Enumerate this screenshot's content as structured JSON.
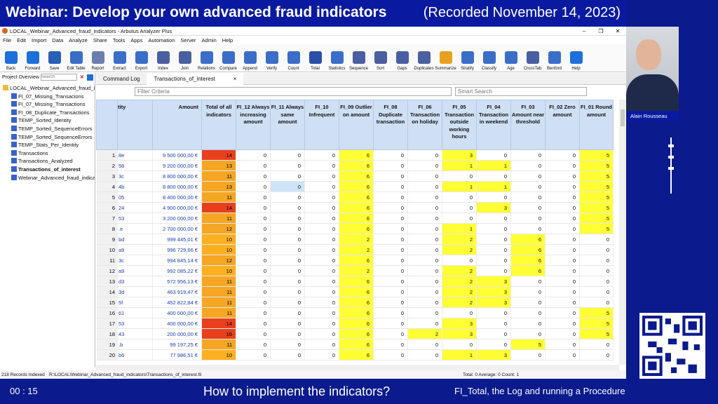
{
  "banner": {
    "title": "Webinar: Develop your own advanced fraud indicators",
    "date": "(Recorded November 14, 2023)"
  },
  "window": {
    "title": "LOCAL_Webinar_Advanced_fraud_indicators - Arbutus Analyzer Plus"
  },
  "menu": [
    "File",
    "Edit",
    "Import",
    "Data",
    "Analyze",
    "Share",
    "Tools",
    "Apps",
    "Automation",
    "Server",
    "Admin",
    "Help"
  ],
  "toolbar": [
    {
      "label": "Back",
      "icon": "back-arrow-icon",
      "color": "#1e6fd9"
    },
    {
      "label": "Forward",
      "icon": "forward-arrow-icon",
      "color": "#1e6fd9"
    },
    {
      "label": "Save",
      "icon": "save-icon",
      "color": "#2a5fb8"
    },
    {
      "label": "Edit Table",
      "icon": "edit-table-icon",
      "color": "#3a6ec8"
    },
    {
      "label": "Report",
      "icon": "report-icon",
      "color": "#6a7fb0"
    },
    {
      "label": "Extract",
      "icon": "extract-icon",
      "color": "#3a6ec8"
    },
    {
      "label": "Export",
      "icon": "export-icon",
      "color": "#3a6ec8"
    },
    {
      "label": "Index",
      "icon": "index-icon",
      "color": "#4a5fa0"
    },
    {
      "label": "Join",
      "icon": "join-icon",
      "color": "#4a5fa0"
    },
    {
      "label": "Relations",
      "icon": "relations-icon",
      "color": "#3a6ec8"
    },
    {
      "label": "Compare",
      "icon": "compare-icon",
      "color": "#3a6ec8"
    },
    {
      "label": "Append",
      "icon": "append-icon",
      "color": "#3a6ec8"
    },
    {
      "label": "Verify",
      "icon": "verify-icon",
      "color": "#3a6ec8"
    },
    {
      "label": "Count",
      "icon": "count-icon",
      "color": "#3a6ec8"
    },
    {
      "label": "Total",
      "icon": "total-icon",
      "color": "#2a4fa8"
    },
    {
      "label": "Statistics",
      "icon": "statistics-icon",
      "color": "#3a6ec8"
    },
    {
      "label": "Sequence",
      "icon": "sequence-icon",
      "color": "#4a5fa0"
    },
    {
      "label": "Sort",
      "icon": "sort-icon",
      "color": "#4a5fa0"
    },
    {
      "label": "Gaps",
      "icon": "gaps-icon",
      "color": "#4a5fa0"
    },
    {
      "label": "Duplicates",
      "icon": "duplicates-icon",
      "color": "#4a5fa0"
    },
    {
      "label": "Summarize",
      "icon": "summarize-icon",
      "color": "#e8a020"
    },
    {
      "label": "Stratify",
      "icon": "stratify-icon",
      "color": "#3a6ec8"
    },
    {
      "label": "Classify",
      "icon": "classify-icon",
      "color": "#3a6ec8"
    },
    {
      "label": "Age",
      "icon": "age-icon",
      "color": "#3a6ec8"
    },
    {
      "label": "CrossTab",
      "icon": "crosstab-icon",
      "color": "#4a5fa0"
    },
    {
      "label": "Benford",
      "icon": "benford-icon",
      "color": "#3a6ec8"
    },
    {
      "label": "Help",
      "icon": "help-icon",
      "color": "#1e6fd9"
    }
  ],
  "project": {
    "label": "Project Overview",
    "search_placeholder": "Search",
    "items": [
      {
        "label": "LOCAL_Webinar_Advanced_fraud_indicators",
        "bold": false,
        "root": true
      },
      {
        "label": "FI_07_Missing_Transacions",
        "bold": false
      },
      {
        "label": "FI_07_Missing_Transactions",
        "bold": false
      },
      {
        "label": "FI_08_Duplicate_Transactions",
        "bold": false
      },
      {
        "label": "TEMP_Sorted_Identity",
        "bold": false
      },
      {
        "label": "TEMP_Sorted_SequenceErrors",
        "bold": false
      },
      {
        "label": "TEMP_Sorted_SequenceErrors",
        "bold": false
      },
      {
        "label": "TEMP_Stats_Per_Identity",
        "bold": false
      },
      {
        "label": "Transactions",
        "bold": false
      },
      {
        "label": "Transactions_Analyzed",
        "bold": false
      },
      {
        "label": "Transactions_of_interest",
        "bold": true
      },
      {
        "label": "Webinar_Advanced_fraud_indicators",
        "bold": false
      }
    ]
  },
  "tabs": [
    {
      "label": "Command Log",
      "active": false
    },
    {
      "label": "Transactions_of_interest",
      "active": true
    }
  ],
  "tab_close": "×",
  "filter": {
    "placeholder": "Filter Criteria"
  },
  "smart_search": {
    "placeholder": "Smart Search"
  },
  "table": {
    "columns": [
      "",
      "tity",
      "Amount",
      "Total of all indicators",
      "FI_12 Always increasing amount",
      "FI_11 Always same amount",
      "FI_10 Infrequent",
      "FI_09 Outlier on amount",
      "FI_08 Duplicate transaction",
      "FI_06 Transaction on holiday",
      "FI_05 Transaction outside working hours",
      "FI_04 Transaction in weekend",
      "FI_03 Amount near threshold",
      "FI_02 Zero amount",
      "FI_01 Round amount"
    ],
    "rows": [
      [
        "1",
        "8e",
        "9 500 000,00 €",
        "14",
        "0",
        "0",
        "0",
        "6",
        "0",
        "0",
        "3",
        "0",
        "0",
        "0",
        "5"
      ],
      [
        "2",
        "58",
        "9 200 000,00 €",
        "13",
        "0",
        "0",
        "0",
        "6",
        "0",
        "0",
        "1",
        "1",
        "0",
        "0",
        "5"
      ],
      [
        "3",
        "3c",
        "8 800 000,00 €",
        "11",
        "0",
        "0",
        "0",
        "6",
        "0",
        "0",
        "0",
        "0",
        "0",
        "0",
        "5"
      ],
      [
        "4",
        "4b",
        "8 800 000,00 €",
        "13",
        "0",
        "0",
        "0",
        "6",
        "0",
        "0",
        "1",
        "1",
        "0",
        "0",
        "5"
      ],
      [
        "5",
        "05",
        "8 400 000,00 €",
        "11",
        "0",
        "0",
        "0",
        "6",
        "0",
        "0",
        "0",
        "0",
        "0",
        "0",
        "5"
      ],
      [
        "6",
        "24",
        "4 900 000,00 €",
        "14",
        "0",
        "0",
        "0",
        "6",
        "0",
        "0",
        "0",
        "3",
        "0",
        "0",
        "5"
      ],
      [
        "7",
        "53",
        "3 200 000,00 €",
        "11",
        "0",
        "0",
        "0",
        "6",
        "0",
        "0",
        "0",
        "0",
        "0",
        "0",
        "5"
      ],
      [
        "8",
        ".e",
        "2 700 000,00 €",
        "12",
        "0",
        "0",
        "0",
        "6",
        "0",
        "0",
        "1",
        "0",
        "0",
        "0",
        "5"
      ],
      [
        "9",
        "bd",
        "999 445,01 €",
        "10",
        "0",
        "0",
        "0",
        "2",
        "0",
        "0",
        "2",
        "0",
        "6",
        "0",
        "0"
      ],
      [
        "10",
        "a9",
        "996 729,66 €",
        "10",
        "0",
        "0",
        "0",
        "2",
        "0",
        "0",
        "2",
        "0",
        "6",
        "0",
        "0"
      ],
      [
        "11",
        "3c",
        "994 845,14 €",
        "12",
        "0",
        "0",
        "0",
        "6",
        "0",
        "0",
        "0",
        "0",
        "6",
        "0",
        "0"
      ],
      [
        "12",
        "a9",
        "992 085,22 €",
        "10",
        "0",
        "0",
        "0",
        "2",
        "0",
        "0",
        "2",
        "0",
        "6",
        "0",
        "0"
      ],
      [
        "13",
        "d3",
        "572 956,13 €",
        "11",
        "0",
        "0",
        "0",
        "6",
        "0",
        "0",
        "2",
        "3",
        "0",
        "0",
        "0"
      ],
      [
        "14",
        "3d",
        "463 919,47 €",
        "11",
        "0",
        "0",
        "0",
        "6",
        "0",
        "0",
        "2",
        "3",
        "0",
        "0",
        "0"
      ],
      [
        "15",
        "5f",
        "452 822,84 €",
        "11",
        "0",
        "0",
        "0",
        "6",
        "0",
        "0",
        "2",
        "3",
        "0",
        "0",
        "0"
      ],
      [
        "16",
        "61",
        "400 000,00 €",
        "11",
        "0",
        "0",
        "0",
        "6",
        "0",
        "0",
        "0",
        "0",
        "0",
        "0",
        "5"
      ],
      [
        "17",
        "53",
        "400 000,00 €",
        "14",
        "0",
        "0",
        "0",
        "6",
        "0",
        "0",
        "3",
        "0",
        "0",
        "0",
        "5"
      ],
      [
        "18",
        "43",
        "200 000,00 €",
        "16",
        "0",
        "0",
        "0",
        "6",
        "0",
        "2",
        "3",
        "0",
        "0",
        "0",
        "5"
      ],
      [
        "19",
        ".b",
        "99 197,25 €",
        "11",
        "0",
        "0",
        "0",
        "6",
        "0",
        "0",
        "0",
        "0",
        "5",
        "0",
        "0"
      ],
      [
        "20",
        "b6",
        "77 986,51 €",
        "10",
        "0",
        "0",
        "0",
        "6",
        "0",
        "0",
        "1",
        "3",
        "0",
        "0",
        "0"
      ]
    ]
  },
  "status": {
    "records": "218 Records Indexed",
    "path": "R:\\LOCAL\\Webinar_Advanced_fraud_indicators\\Transactions_of_interest.fil",
    "summary": "Total: 0  Average: 0  Count: 1"
  },
  "presenter": {
    "name": "Alain Rousseau"
  },
  "bottom": {
    "timer": "00 : 15",
    "center": "How to implement the indicators?",
    "right": "FI_Total, the Log and running a Procedure"
  },
  "colors": {
    "total_high": "#e8401c",
    "total_mid": "#f5a623",
    "total_low": "#ffb020",
    "highlight": "#ffff33",
    "selected": "#cce4f7",
    "banner": "#0a1aa0"
  }
}
